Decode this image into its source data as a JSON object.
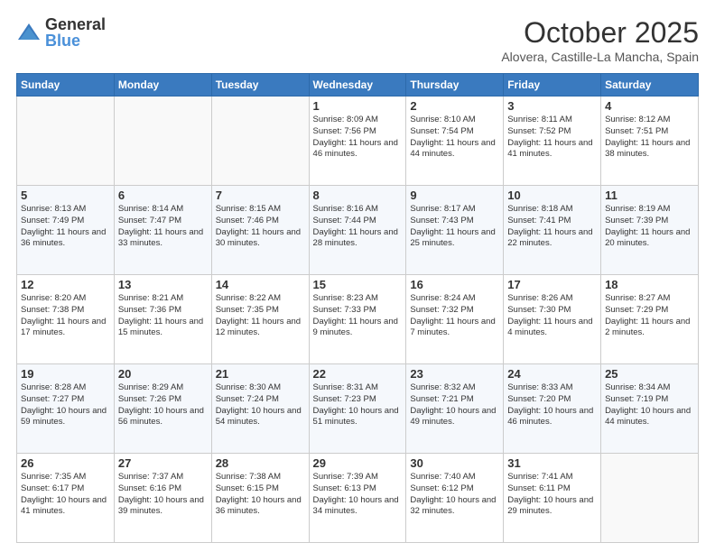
{
  "logo": {
    "general": "General",
    "blue": "Blue"
  },
  "title": "October 2025",
  "location": "Alovera, Castille-La Mancha, Spain",
  "weekdays": [
    "Sunday",
    "Monday",
    "Tuesday",
    "Wednesday",
    "Thursday",
    "Friday",
    "Saturday"
  ],
  "weeks": [
    [
      {
        "day": "",
        "empty": true
      },
      {
        "day": "",
        "empty": true
      },
      {
        "day": "",
        "empty": true
      },
      {
        "day": "1",
        "sunrise": "8:09 AM",
        "sunset": "7:56 PM",
        "daylight": "11 hours and 46 minutes."
      },
      {
        "day": "2",
        "sunrise": "8:10 AM",
        "sunset": "7:54 PM",
        "daylight": "11 hours and 44 minutes."
      },
      {
        "day": "3",
        "sunrise": "8:11 AM",
        "sunset": "7:52 PM",
        "daylight": "11 hours and 41 minutes."
      },
      {
        "day": "4",
        "sunrise": "8:12 AM",
        "sunset": "7:51 PM",
        "daylight": "11 hours and 38 minutes."
      }
    ],
    [
      {
        "day": "5",
        "sunrise": "8:13 AM",
        "sunset": "7:49 PM",
        "daylight": "11 hours and 36 minutes."
      },
      {
        "day": "6",
        "sunrise": "8:14 AM",
        "sunset": "7:47 PM",
        "daylight": "11 hours and 33 minutes."
      },
      {
        "day": "7",
        "sunrise": "8:15 AM",
        "sunset": "7:46 PM",
        "daylight": "11 hours and 30 minutes."
      },
      {
        "day": "8",
        "sunrise": "8:16 AM",
        "sunset": "7:44 PM",
        "daylight": "11 hours and 28 minutes."
      },
      {
        "day": "9",
        "sunrise": "8:17 AM",
        "sunset": "7:43 PM",
        "daylight": "11 hours and 25 minutes."
      },
      {
        "day": "10",
        "sunrise": "8:18 AM",
        "sunset": "7:41 PM",
        "daylight": "11 hours and 22 minutes."
      },
      {
        "day": "11",
        "sunrise": "8:19 AM",
        "sunset": "7:39 PM",
        "daylight": "11 hours and 20 minutes."
      }
    ],
    [
      {
        "day": "12",
        "sunrise": "8:20 AM",
        "sunset": "7:38 PM",
        "daylight": "11 hours and 17 minutes."
      },
      {
        "day": "13",
        "sunrise": "8:21 AM",
        "sunset": "7:36 PM",
        "daylight": "11 hours and 15 minutes."
      },
      {
        "day": "14",
        "sunrise": "8:22 AM",
        "sunset": "7:35 PM",
        "daylight": "11 hours and 12 minutes."
      },
      {
        "day": "15",
        "sunrise": "8:23 AM",
        "sunset": "7:33 PM",
        "daylight": "11 hours and 9 minutes."
      },
      {
        "day": "16",
        "sunrise": "8:24 AM",
        "sunset": "7:32 PM",
        "daylight": "11 hours and 7 minutes."
      },
      {
        "day": "17",
        "sunrise": "8:26 AM",
        "sunset": "7:30 PM",
        "daylight": "11 hours and 4 minutes."
      },
      {
        "day": "18",
        "sunrise": "8:27 AM",
        "sunset": "7:29 PM",
        "daylight": "11 hours and 2 minutes."
      }
    ],
    [
      {
        "day": "19",
        "sunrise": "8:28 AM",
        "sunset": "7:27 PM",
        "daylight": "10 hours and 59 minutes."
      },
      {
        "day": "20",
        "sunrise": "8:29 AM",
        "sunset": "7:26 PM",
        "daylight": "10 hours and 56 minutes."
      },
      {
        "day": "21",
        "sunrise": "8:30 AM",
        "sunset": "7:24 PM",
        "daylight": "10 hours and 54 minutes."
      },
      {
        "day": "22",
        "sunrise": "8:31 AM",
        "sunset": "7:23 PM",
        "daylight": "10 hours and 51 minutes."
      },
      {
        "day": "23",
        "sunrise": "8:32 AM",
        "sunset": "7:21 PM",
        "daylight": "10 hours and 49 minutes."
      },
      {
        "day": "24",
        "sunrise": "8:33 AM",
        "sunset": "7:20 PM",
        "daylight": "10 hours and 46 minutes."
      },
      {
        "day": "25",
        "sunrise": "8:34 AM",
        "sunset": "7:19 PM",
        "daylight": "10 hours and 44 minutes."
      }
    ],
    [
      {
        "day": "26",
        "sunrise": "7:35 AM",
        "sunset": "6:17 PM",
        "daylight": "10 hours and 41 minutes."
      },
      {
        "day": "27",
        "sunrise": "7:37 AM",
        "sunset": "6:16 PM",
        "daylight": "10 hours and 39 minutes."
      },
      {
        "day": "28",
        "sunrise": "7:38 AM",
        "sunset": "6:15 PM",
        "daylight": "10 hours and 36 minutes."
      },
      {
        "day": "29",
        "sunrise": "7:39 AM",
        "sunset": "6:13 PM",
        "daylight": "10 hours and 34 minutes."
      },
      {
        "day": "30",
        "sunrise": "7:40 AM",
        "sunset": "6:12 PM",
        "daylight": "10 hours and 32 minutes."
      },
      {
        "day": "31",
        "sunrise": "7:41 AM",
        "sunset": "6:11 PM",
        "daylight": "10 hours and 29 minutes."
      },
      {
        "day": "",
        "empty": true
      }
    ]
  ]
}
